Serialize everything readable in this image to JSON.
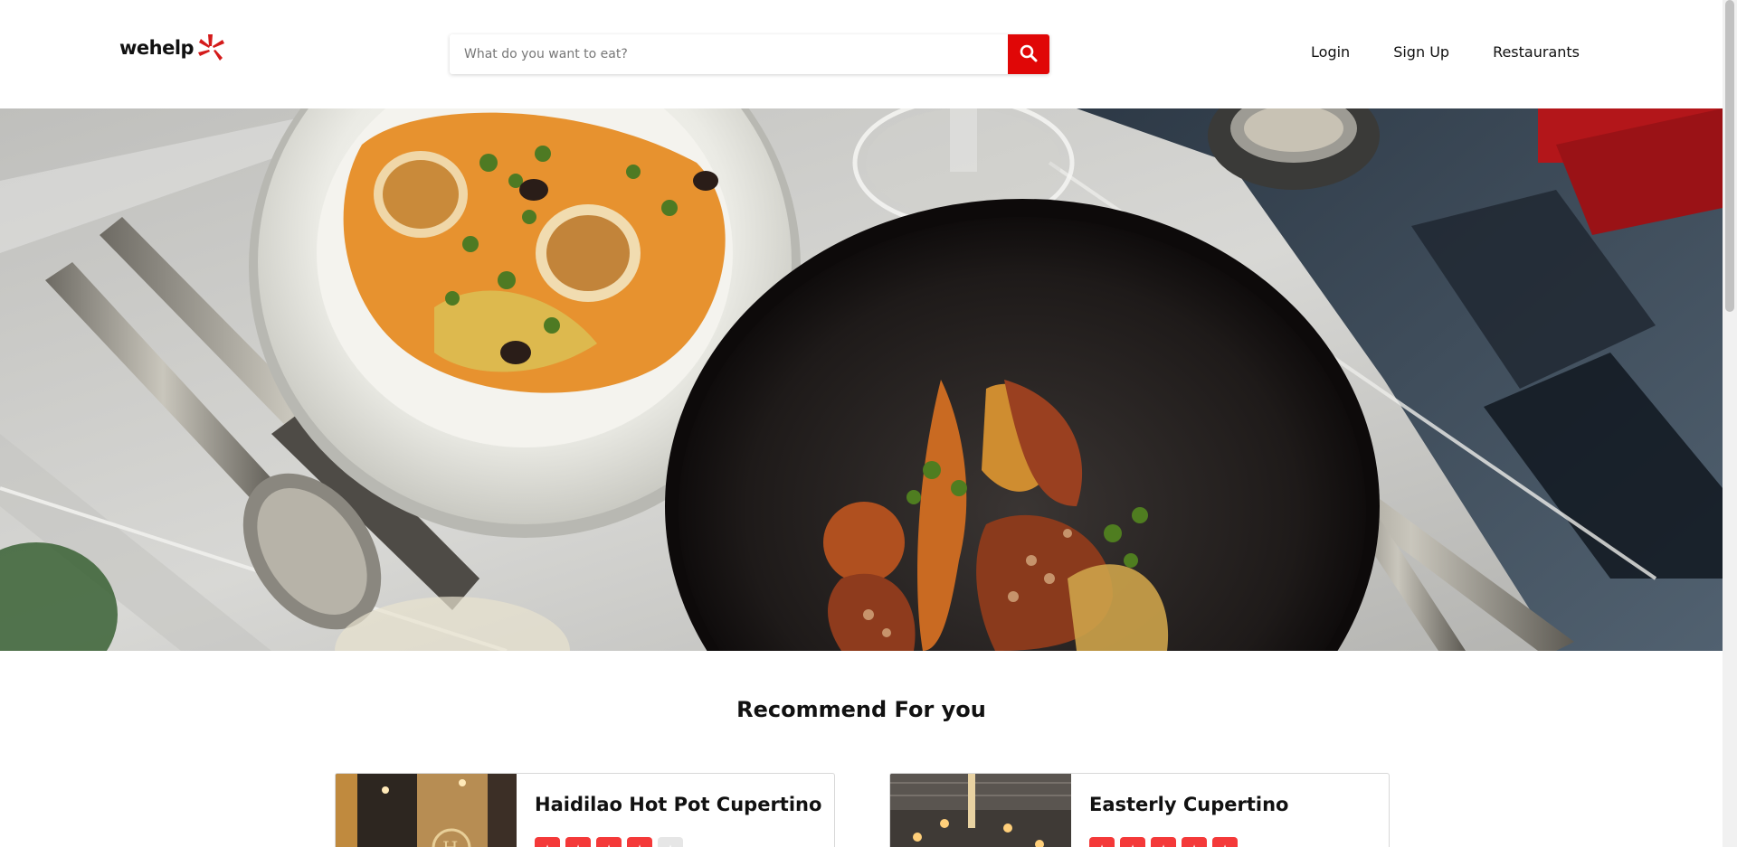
{
  "header": {
    "logo_text": "wehelp",
    "search_placeholder": "What do you want to eat?",
    "nav": {
      "login": "Login",
      "signup": "Sign Up",
      "restaurants": "Restaurants"
    }
  },
  "section": {
    "title": "Recommend For you"
  },
  "cards": [
    {
      "name": "Haidilao Hot Pot Cupertino",
      "rating": 4
    },
    {
      "name": "Easterly Cupertino",
      "rating": 5
    }
  ],
  "colors": {
    "accent": "#e00707",
    "star_filled": "#f43939",
    "star_empty": "#e6e6e6"
  },
  "icons": {
    "search": "search-icon",
    "logo_mark": "burst-logo-icon",
    "star": "star-icon"
  }
}
